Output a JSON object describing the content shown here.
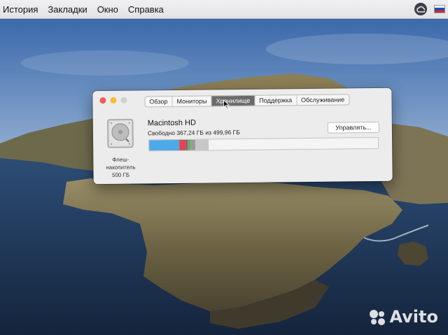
{
  "menubar": {
    "items": [
      "История",
      "Закладки",
      "Окно",
      "Справка"
    ],
    "status_icons": [
      "creative-cloud-icon",
      "russian-flag-icon"
    ]
  },
  "window": {
    "tabs": [
      {
        "label": "Обзор",
        "active": false
      },
      {
        "label": "Мониторы",
        "active": false
      },
      {
        "label": "Хранилище",
        "active": true
      },
      {
        "label": "Поддержка",
        "active": false
      },
      {
        "label": "Обслуживание",
        "active": false
      }
    ],
    "disk": {
      "name": "Macintosh HD",
      "free_text": "Свободно 367,24 ГБ из 499,96 ГБ",
      "type_line1": "Флеш-",
      "type_line2": "накопитель",
      "capacity": "500 ГБ",
      "icon": "hard-drive-icon"
    },
    "manage_button": "Управлять...",
    "storage_usage": {
      "total_gb": 499.96,
      "free_gb": 367.24,
      "segments": [
        {
          "category": "system",
          "color": "#4ea9e8",
          "fraction": 0.13
        },
        {
          "category": "apps",
          "color": "#e04848",
          "fraction": 0.03
        },
        {
          "category": "photos",
          "color": "#a64a9c",
          "fraction": 0.008
        },
        {
          "category": "documents",
          "color": "#59b84d",
          "fraction": 0.013
        },
        {
          "category": "other",
          "color": "#9a9a9a",
          "fraction": 0.02
        },
        {
          "category": "purgeable",
          "color": "#c7c7c7",
          "fraction": 0.06
        }
      ]
    }
  },
  "watermark": {
    "text": "Avito"
  },
  "colors": {
    "accent_tab": "#6b6b6b",
    "window_bg": "#ececec",
    "close": "#f05c55",
    "minimize": "#f6be32"
  }
}
